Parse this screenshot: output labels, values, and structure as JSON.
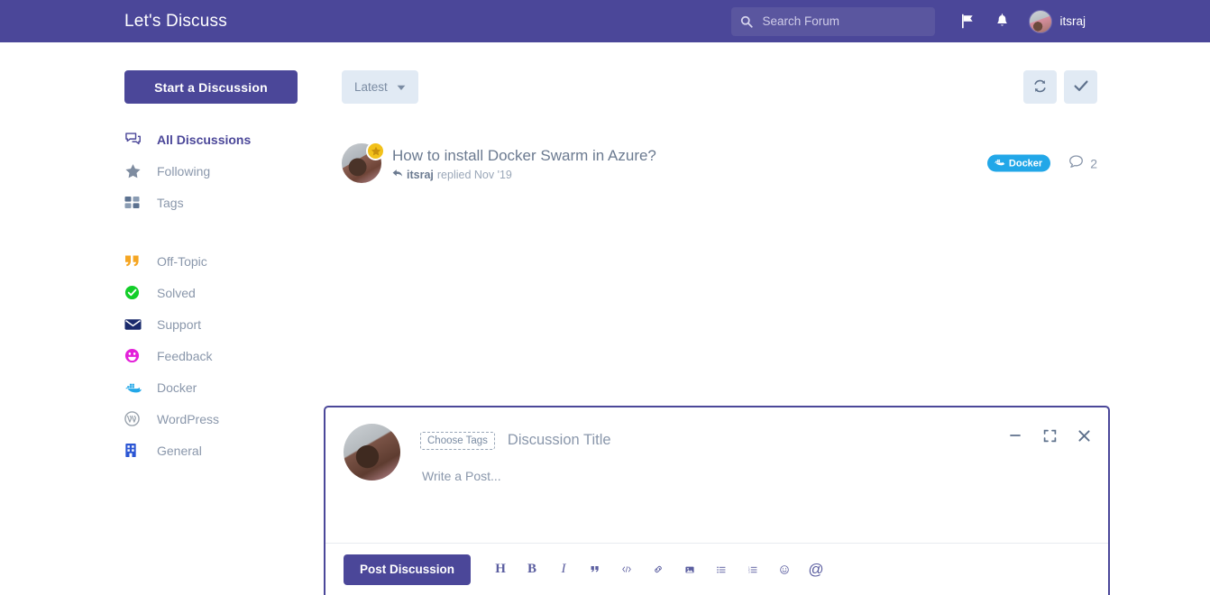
{
  "header": {
    "brand": "Let's Discuss",
    "search": {
      "placeholder": "Search Forum",
      "value": "",
      "icon": "search-icon"
    },
    "flag_icon": "flag-icon",
    "bell_icon": "bell-icon",
    "user": "itsraj"
  },
  "sidebar": {
    "start_button": "Start a Discussion",
    "primary": [
      {
        "label": "All Discussions",
        "icon": "discussions-icon",
        "active": true
      },
      {
        "label": "Following",
        "icon": "star-icon",
        "active": false
      },
      {
        "label": "Tags",
        "icon": "tags-grid-icon",
        "active": false
      }
    ],
    "tags": [
      {
        "label": "Off-Topic",
        "icon": "quote-icon",
        "color": "#f5a623"
      },
      {
        "label": "Solved",
        "icon": "check-circle-icon",
        "color": "#13ce29"
      },
      {
        "label": "Support",
        "icon": "envelope-icon",
        "color": "#1a2a6c"
      },
      {
        "label": "Feedback",
        "icon": "smiley-icon",
        "color": "#e321d9"
      },
      {
        "label": "Docker",
        "icon": "docker-whale-icon",
        "color": "#22a7e8"
      },
      {
        "label": "WordPress",
        "icon": "wordpress-icon",
        "color": "#9aa3ad"
      },
      {
        "label": "General",
        "icon": "building-icon",
        "color": "#2b56d4"
      }
    ]
  },
  "main": {
    "sort": {
      "label": "Latest",
      "icon": "chevron-down-icon"
    },
    "toolbar": [
      {
        "name": "refresh-button",
        "icon": "refresh-icon"
      },
      {
        "name": "mark-all-read-button",
        "icon": "check-icon"
      }
    ],
    "discussions": [
      {
        "title": "How to install Docker Swarm in Azure?",
        "author": "itsraj",
        "activity": "replied Nov '19",
        "reply_icon": "reply-arrow-icon",
        "badge": "star-badge-icon",
        "tag": {
          "label": "Docker",
          "color": "#22a7e8",
          "icon": "docker-whale-icon"
        },
        "comments": "2",
        "comment_icon": "comment-bubble-icon"
      }
    ]
  },
  "composer": {
    "choose_tags": "Choose Tags",
    "title_placeholder": "Discussion Title",
    "title_value": "",
    "body_placeholder": "Write a Post...",
    "body_value": "",
    "post_button": "Post Discussion",
    "window_controls": [
      {
        "name": "minimize-button",
        "icon": "minimize-icon"
      },
      {
        "name": "fullscreen-button",
        "icon": "fullscreen-icon"
      },
      {
        "name": "close-button",
        "icon": "close-icon"
      }
    ],
    "format_buttons": [
      {
        "name": "heading-button",
        "icon": "heading-icon",
        "glyph": "H"
      },
      {
        "name": "bold-button",
        "icon": "bold-icon",
        "glyph": "B"
      },
      {
        "name": "italic-button",
        "icon": "italic-icon",
        "glyph": "I"
      },
      {
        "name": "quote-button",
        "icon": "blockquote-icon",
        "glyph": "“"
      },
      {
        "name": "code-button",
        "icon": "code-icon",
        "glyph": "</>"
      },
      {
        "name": "link-button",
        "icon": "link-icon",
        "glyph": "🔗"
      },
      {
        "name": "image-button",
        "icon": "image-icon",
        "glyph": "🖼"
      },
      {
        "name": "bullet-list-button",
        "icon": "bullet-list-icon",
        "glyph": "≡"
      },
      {
        "name": "numbered-list-button",
        "icon": "numbered-list-icon",
        "glyph": "≡"
      },
      {
        "name": "emoji-button",
        "icon": "emoji-icon",
        "glyph": "☺"
      },
      {
        "name": "mention-button",
        "icon": "mention-icon",
        "glyph": "@"
      }
    ]
  },
  "colors": {
    "brand_purple": "#4b4799",
    "panel_blue": "#e1eaf4",
    "muted_text": "#8a97ab",
    "tag_docker": "#22a7e8"
  }
}
